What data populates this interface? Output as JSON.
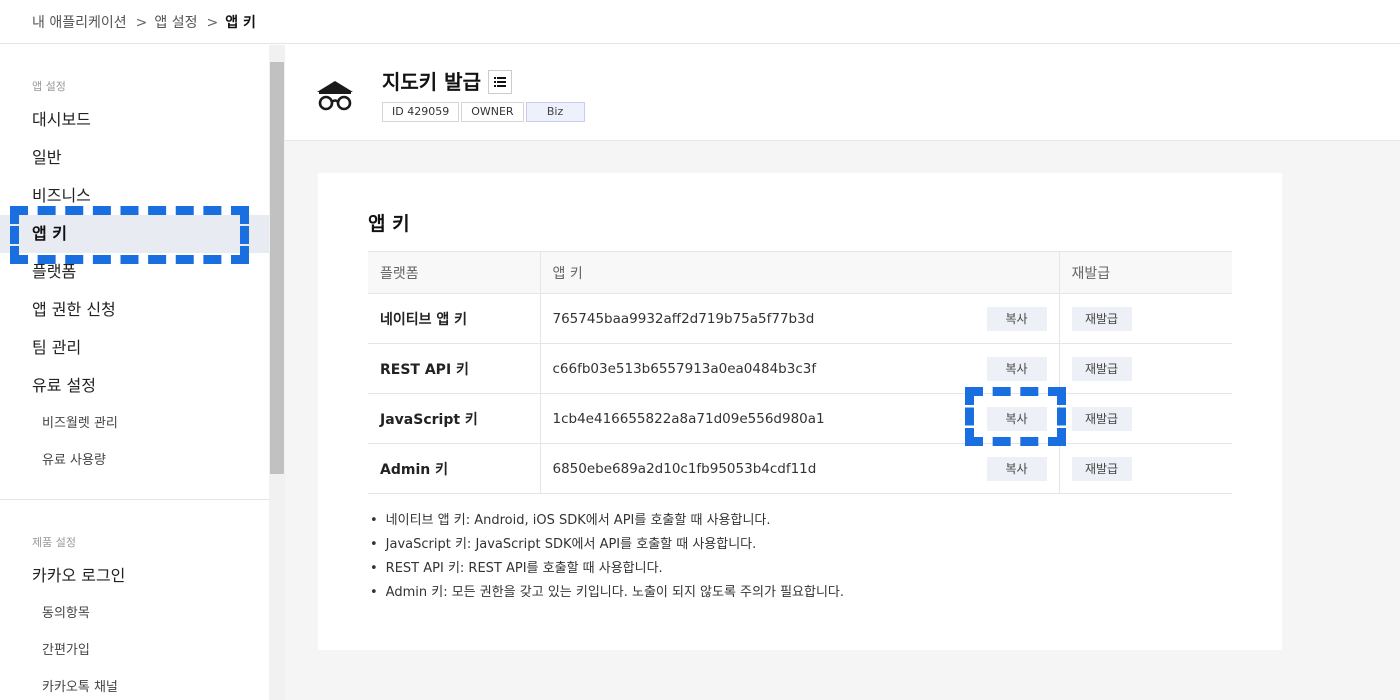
{
  "breadcrumb": {
    "items": [
      "내 애플리케이션",
      "앱 설정",
      "앱 키"
    ],
    "separator": ">"
  },
  "sidebar": {
    "app_settings_title": "앱 설정",
    "app_items": [
      {
        "label": "대시보드"
      },
      {
        "label": "일반"
      },
      {
        "label": "비즈니스"
      },
      {
        "label": "앱 키",
        "active": true
      },
      {
        "label": "플랫폼"
      },
      {
        "label": "앱 권한 신청"
      },
      {
        "label": "팀 관리"
      },
      {
        "label": "유료 설정"
      },
      {
        "label": "비즈월렛 관리",
        "sub": true
      },
      {
        "label": "유료 사용량",
        "sub": true
      }
    ],
    "product_settings_title": "제품 설정",
    "product_items": [
      {
        "label": "카카오 로그인"
      },
      {
        "label": "동의항목",
        "sub": true
      },
      {
        "label": "간편가입",
        "sub": true
      },
      {
        "label": "카카오톡 채널",
        "sub": true
      }
    ]
  },
  "app": {
    "title": "지도키 발급",
    "icon": "glasses-hat-icon",
    "tags": [
      "ID 429059",
      "OWNER",
      "Biz"
    ]
  },
  "keys_section": {
    "title": "앱 키",
    "headers": [
      "플랫폼",
      "앱 키",
      "재발급"
    ],
    "copy_label": "복사",
    "reissue_label": "재발급",
    "rows": [
      {
        "platform": "네이티브 앱 키",
        "key": "765745baa9932aff2d719b75a5f77b3d"
      },
      {
        "platform": "REST API 키",
        "key": "c66fb03e513b6557913a0ea0484b3c3f"
      },
      {
        "platform": "JavaScript 키",
        "key": "1cb4e416655822a8a71d09e556d980a1"
      },
      {
        "platform": "Admin 키",
        "key": "6850ebe689a2d10c1fb95053b4cdf11d"
      }
    ],
    "notes": [
      "네이티브 앱 키: Android, iOS SDK에서 API를 호출할 때 사용합니다.",
      "JavaScript 키: JavaScript SDK에서 API를 호출할 때 사용합니다.",
      "REST API 키: REST API를 호출할 때 사용합니다.",
      "Admin 키: 모든 권한을 갖고 있는 키입니다. 노출이 되지 않도록 주의가 필요합니다."
    ]
  },
  "colors": {
    "focus_highlight": "#1a6fe0",
    "active_item_bg": "#e9ebf2",
    "button_bg": "#eef0f7"
  }
}
